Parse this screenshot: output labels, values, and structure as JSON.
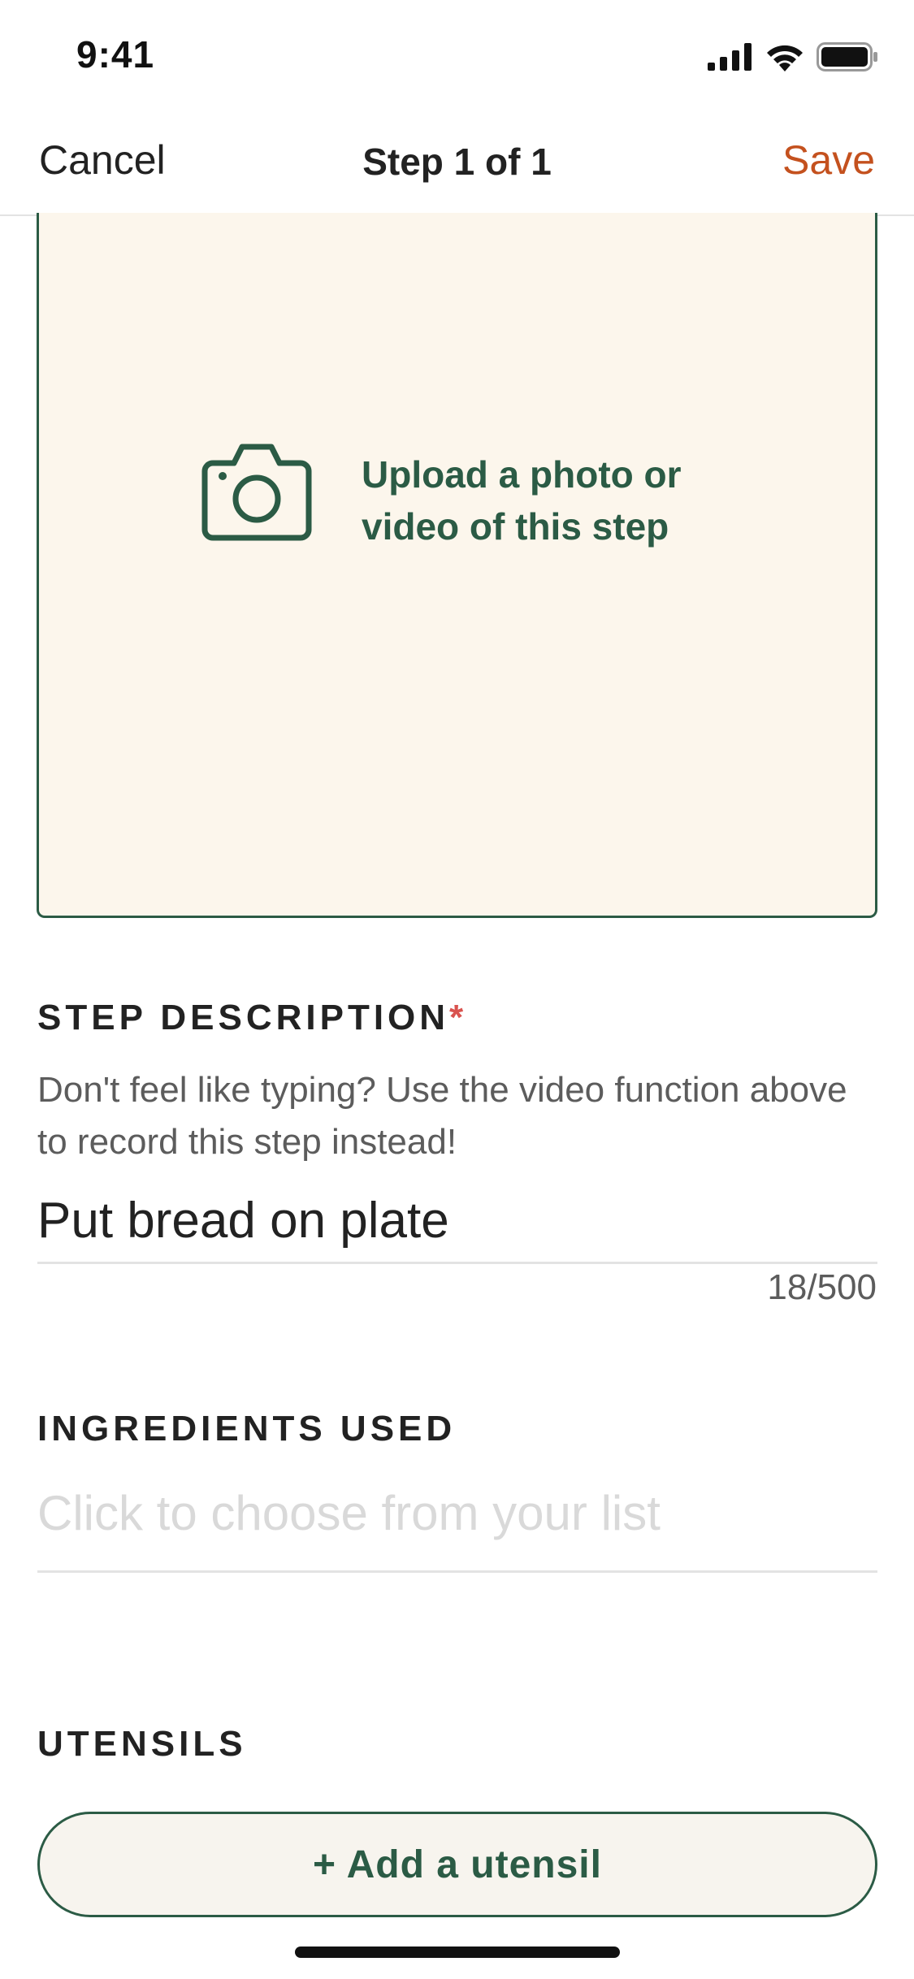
{
  "status_bar": {
    "time": "9:41"
  },
  "nav": {
    "cancel_label": "Cancel",
    "title": "Step 1 of 1",
    "save_label": "Save"
  },
  "upload": {
    "icon": "camera-icon",
    "text": "Upload a photo or video of this step"
  },
  "step_description": {
    "heading": "STEP DESCRIPTION",
    "required_marker": "*",
    "hint": "Don't feel like typing? Use the video function above to record this step instead!",
    "value": "Put bread on plate",
    "char_count": "18/500"
  },
  "ingredients": {
    "heading": "INGREDIENTS USED",
    "placeholder": "Click to choose from your list"
  },
  "utensils": {
    "heading": "UTENSILS",
    "add_button_label": "+ Add a utensil"
  },
  "colors": {
    "accent_green": "#2b5b45",
    "save_orange": "#c4511e",
    "upload_background": "#fcf6ec",
    "required_red": "#d9534f"
  }
}
